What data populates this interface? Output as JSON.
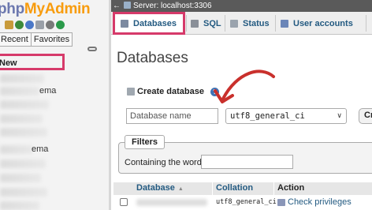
{
  "nav": {
    "logo_php": "php",
    "logo_myadmin": "MyAdmin",
    "tabs": [
      "Recent",
      "Favorites"
    ],
    "new_label": "New",
    "tree_fragments": [
      "ema",
      "ema"
    ]
  },
  "server_bar": {
    "back": "←",
    "label": "Server: localhost:3306"
  },
  "tabs": [
    {
      "label": "Databases",
      "icon": "database-icon",
      "active": true
    },
    {
      "label": "SQL",
      "icon": "sql-icon"
    },
    {
      "label": "Status",
      "icon": "status-icon"
    },
    {
      "label": "User accounts",
      "icon": "user-accounts-icon"
    }
  ],
  "page": {
    "title": "Databases",
    "create_label": "Create database",
    "help": "?",
    "dbname_placeholder": "Database name",
    "collation_value": "utf8_general_ci",
    "create_button": "Create"
  },
  "filters": {
    "legend": "Filters",
    "contains_label": "Containing the word:"
  },
  "table": {
    "headers": [
      "Database",
      "Collation",
      "Action"
    ],
    "sort_glyph": "▲",
    "rows": [
      {
        "collation": "utf8_general_ci",
        "action": "Check privileges"
      }
    ]
  },
  "colors": {
    "highlight": "#d63a6a",
    "link": "#235a81",
    "server_bar": "#5a5a5a",
    "annotation_arrow": "#c9302c"
  }
}
